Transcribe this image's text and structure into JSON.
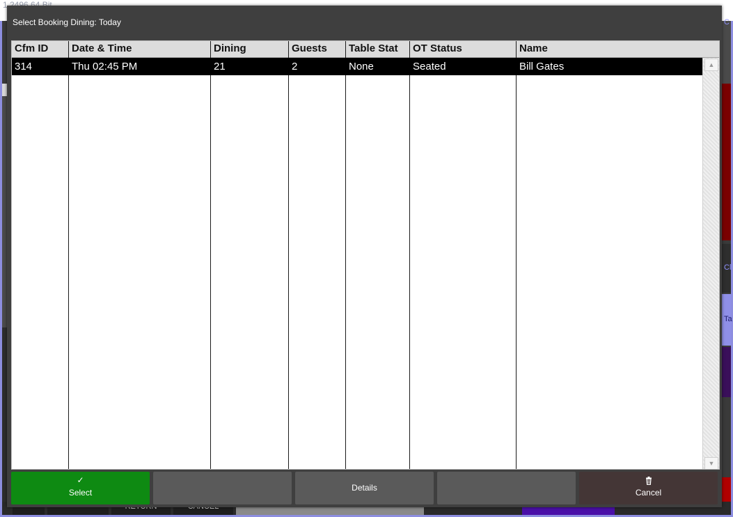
{
  "background_app": {
    "title_text": "1.2496 64 Bit",
    "right_edge_labels": [
      "C",
      "Cl",
      "Ta"
    ],
    "bottom_buttons": [
      "RETURN",
      "CANCEL"
    ],
    "colors": {
      "frame_border": "#8d8ee0",
      "red_tile": "#7a0000",
      "purple_tile": "#3a0f5a",
      "periwinkle_tile": "#8f8fe8"
    }
  },
  "dialog": {
    "title": "Select Booking Dining: Today",
    "table": {
      "columns": [
        "Cfm ID",
        "Date & Time",
        "Dining",
        "Guests",
        "Table Stat",
        "OT Status",
        "Name"
      ],
      "rows": [
        {
          "selected": true,
          "cfm_id": "314",
          "date_time": "Thu 02:45 PM",
          "dining": "21",
          "guests": "2",
          "table_stat": "None",
          "ot_status": "Seated",
          "name": "Bill Gates"
        }
      ]
    },
    "buttons": {
      "select": {
        "label": "Select",
        "icon": "check-icon",
        "color": "#0e8a12"
      },
      "blank1": {
        "label": "",
        "color": "#5a5a5a"
      },
      "details": {
        "label": "Details",
        "color": "#5a5a5a"
      },
      "blank2": {
        "label": "",
        "color": "#5a5a5a"
      },
      "cancel": {
        "label": "Cancel",
        "icon": "trash-icon",
        "color": "#443636"
      }
    }
  }
}
